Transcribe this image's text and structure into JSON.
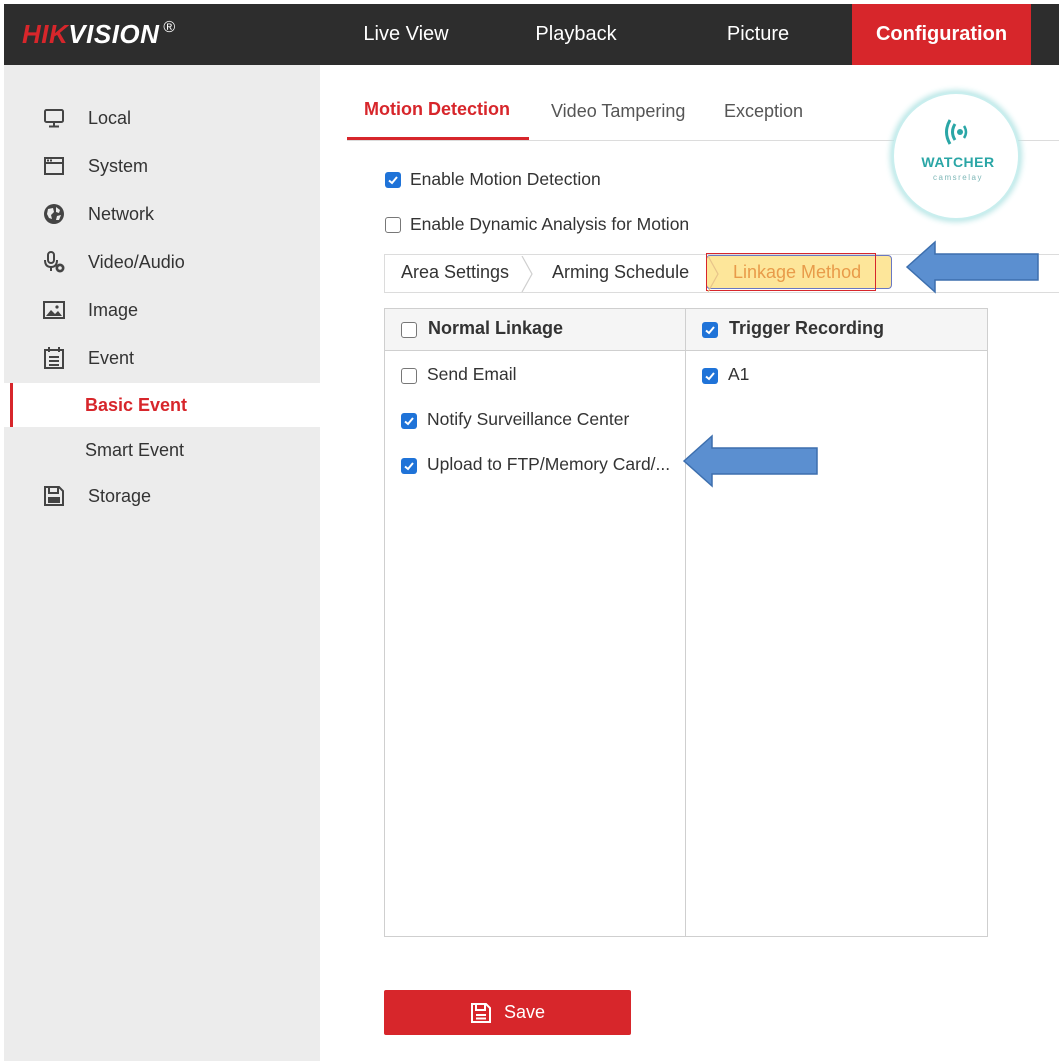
{
  "brand": {
    "part1": "HIK",
    "part2": "VISION",
    "mark": "®"
  },
  "topnav": [
    {
      "label": "Live View",
      "active": false
    },
    {
      "label": "Playback",
      "active": false
    },
    {
      "label": "Picture",
      "active": false
    },
    {
      "label": "Configuration",
      "active": true
    }
  ],
  "sidebar": {
    "items": [
      {
        "label": "Local",
        "icon": "monitor-icon"
      },
      {
        "label": "System",
        "icon": "window-icon"
      },
      {
        "label": "Network",
        "icon": "globe-icon"
      },
      {
        "label": "Video/Audio",
        "icon": "microphone-icon"
      },
      {
        "label": "Image",
        "icon": "image-icon"
      },
      {
        "label": "Event",
        "icon": "calendar-icon"
      },
      {
        "label": "Basic Event",
        "sub": true,
        "selected": true
      },
      {
        "label": "Smart Event",
        "sub": true
      },
      {
        "label": "Storage",
        "icon": "floppy-disk-icon"
      }
    ]
  },
  "subtabs": [
    {
      "label": "Motion Detection",
      "active": true
    },
    {
      "label": "Video Tampering",
      "active": false
    },
    {
      "label": "Exception",
      "active": false
    }
  ],
  "options": {
    "enable_motion": {
      "label": "Enable Motion Detection",
      "checked": true
    },
    "enable_dynamic": {
      "label": "Enable Dynamic Analysis for Motion",
      "checked": false
    }
  },
  "steps": [
    {
      "label": "Area Settings"
    },
    {
      "label": "Arming Schedule"
    },
    {
      "label": "Linkage Method",
      "active": true
    }
  ],
  "linkage": {
    "normal": {
      "header": "Normal Linkage",
      "checked": false,
      "items": [
        {
          "label": "Send Email",
          "checked": false
        },
        {
          "label": "Notify Surveillance Center",
          "checked": true
        },
        {
          "label": "Upload to FTP/Memory Card/...",
          "checked": true
        }
      ]
    },
    "trigger": {
      "header": "Trigger Recording",
      "checked": true,
      "items": [
        {
          "label": "A1",
          "checked": true
        }
      ]
    }
  },
  "save_label": "Save",
  "watermark": {
    "main": "WATCHER",
    "sub": "camsrelay"
  },
  "colors": {
    "accent": "#d7262b",
    "checkbox": "#1f73d8",
    "topbar": "#2d2d2d",
    "arrow": "#5b8fd0"
  }
}
